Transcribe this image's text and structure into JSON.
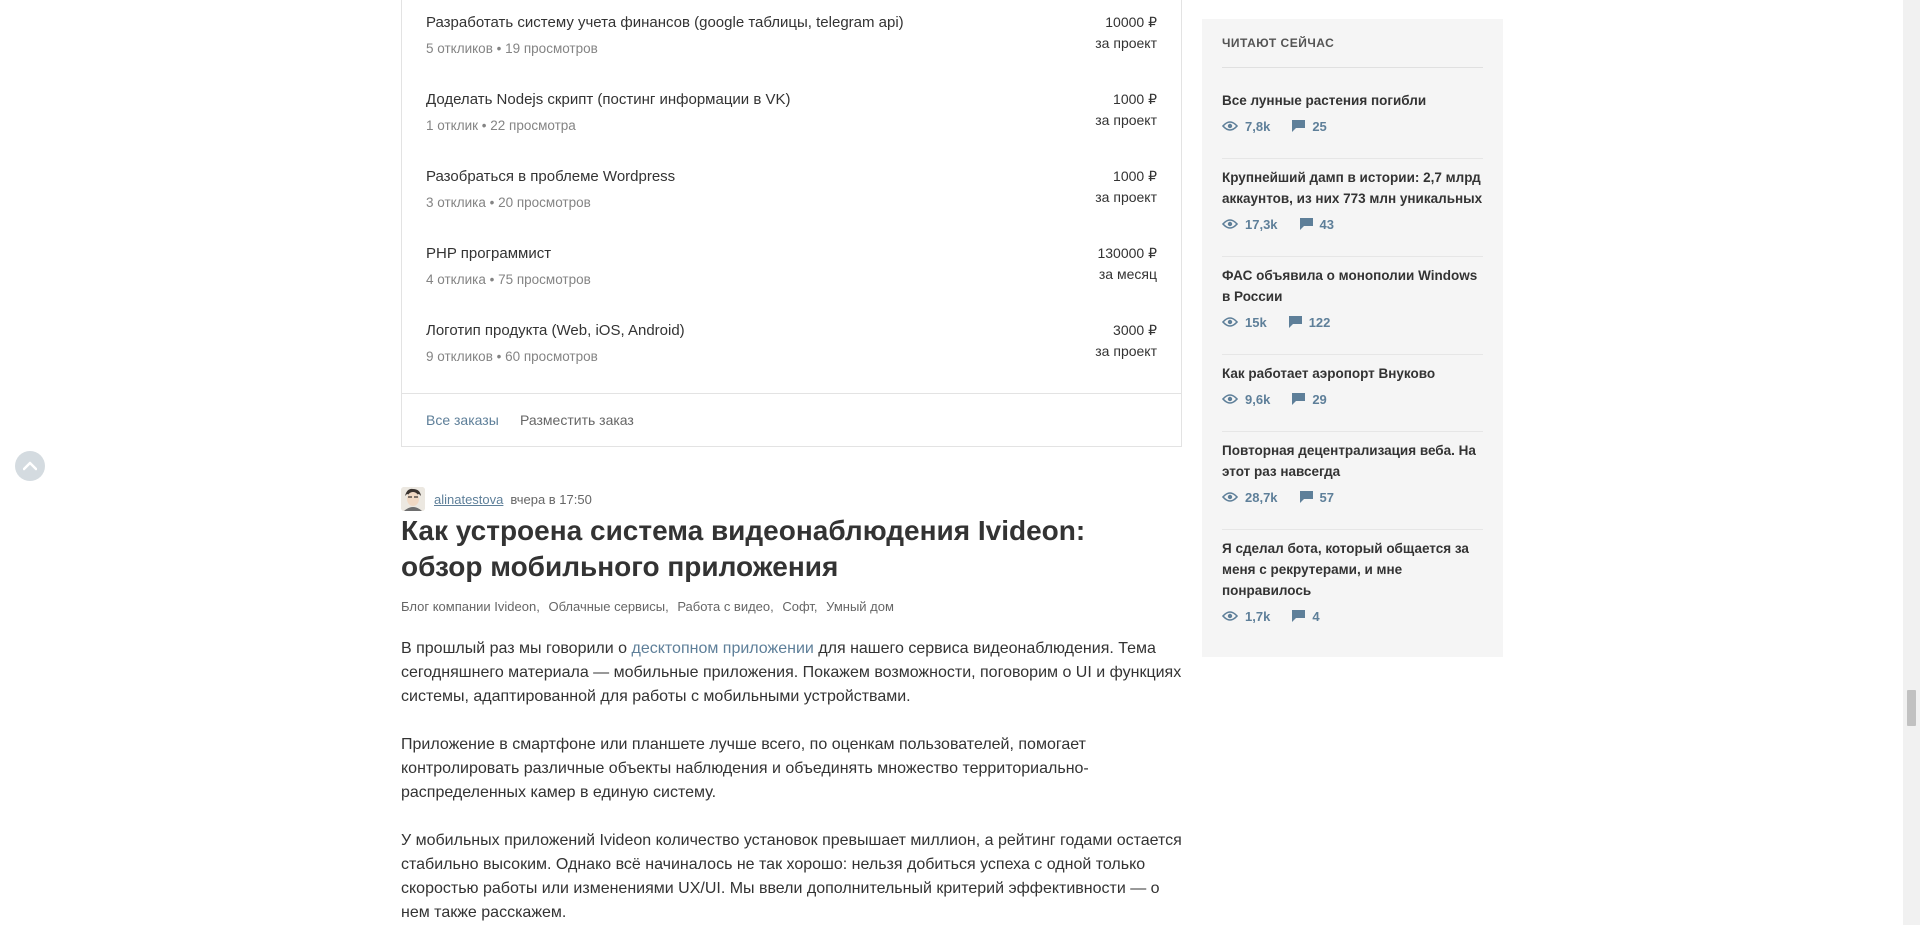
{
  "orders": {
    "items": [
      {
        "title": "Разработать систему учета финансов (google таблицы, telegram api)",
        "meta": "5 откликов • 19 просмотров",
        "price": "10000 ₽",
        "period": "за проект"
      },
      {
        "title": "Доделать Nodejs скрипт (постинг информации в VK)",
        "meta": "1 отклик • 22 просмотра",
        "price": "1000 ₽",
        "period": "за проект"
      },
      {
        "title": "Разобраться в проблеме Wordpress",
        "meta": "3 отклика • 20 просмотров",
        "price": "1000 ₽",
        "period": "за проект"
      },
      {
        "title": "PHP программист",
        "meta": "4 отклика • 75 просмотров",
        "price": "130000 ₽",
        "period": "за месяц"
      },
      {
        "title": "Логотип продукта (Web, iOS, Android)",
        "meta": "9 откликов • 60 просмотров",
        "price": "3000 ₽",
        "period": "за проект"
      }
    ],
    "all_link": "Все заказы",
    "post_link": "Разместить заказ"
  },
  "post": {
    "author": "alinatestova",
    "time": "вчера в 17:50",
    "title": "Как устроена система видеонаблюдения Ivideon: обзор мобильного приложения",
    "hubs": [
      "Блог компании Ivideon,",
      "Облачные сервисы,",
      "Работа с видео,",
      "Софт,",
      "Умный дом"
    ],
    "p1_before": "В прошлый раз мы говорили о ",
    "p1_link": "десктопном приложении",
    "p1_after": " для нашего сервиса видеонаблюдения. Тема сегодняшнего материала — мобильные приложения. Покажем возможности, поговорим о UI и функциях системы, адаптированной для работы с мобильными устройствами.",
    "p2": "Приложение в смартфоне или планшете лучше всего, по оценкам пользователей, помогает контролировать различные объекты наблюдения и объединять множество территориально-распределенных камер в единую систему.",
    "p3": "У мобильных приложений Ivideon количество установок превышает миллион, а рейтинг годами остается стабильно высоким. Однако всё начиналось не так хорошо: нельзя добиться успеха с одной только скоростью работы или изменениями UX/UI. Мы ввели дополнительный критерий эффективности — о нем также расскажем."
  },
  "sidebar": {
    "title": "ЧИТАЮТ СЕЙЧАС",
    "items": [
      {
        "title": "Все лунные растения погибли",
        "views": "7,8k",
        "comments": "25"
      },
      {
        "title": "Крупнейший дамп в истории: 2,7 млрд аккаунтов, из них 773 млн уникальных",
        "views": "17,3k",
        "comments": "43"
      },
      {
        "title": "ФАС объявила о монополии Windows в России",
        "views": "15k",
        "comments": "122"
      },
      {
        "title": "Как работает аэропорт Внуково",
        "views": "9,6k",
        "comments": "29"
      },
      {
        "title": "Повторная децентрализация веба. На этот раз навсегда",
        "views": "28,7k",
        "comments": "57"
      },
      {
        "title": "Я сделал бота, который общается за меня с рекрутерами, и мне понравилось",
        "views": "1,7k",
        "comments": "4"
      }
    ]
  },
  "colors": {
    "accent": "#5e7f99",
    "text": "#333333",
    "muted": "#848484",
    "sidebar_bg": "#f5f5f5"
  },
  "icons": {
    "views": "eye-icon",
    "comments": "comment-icon",
    "scroll_up": "chevron-up-icon"
  }
}
